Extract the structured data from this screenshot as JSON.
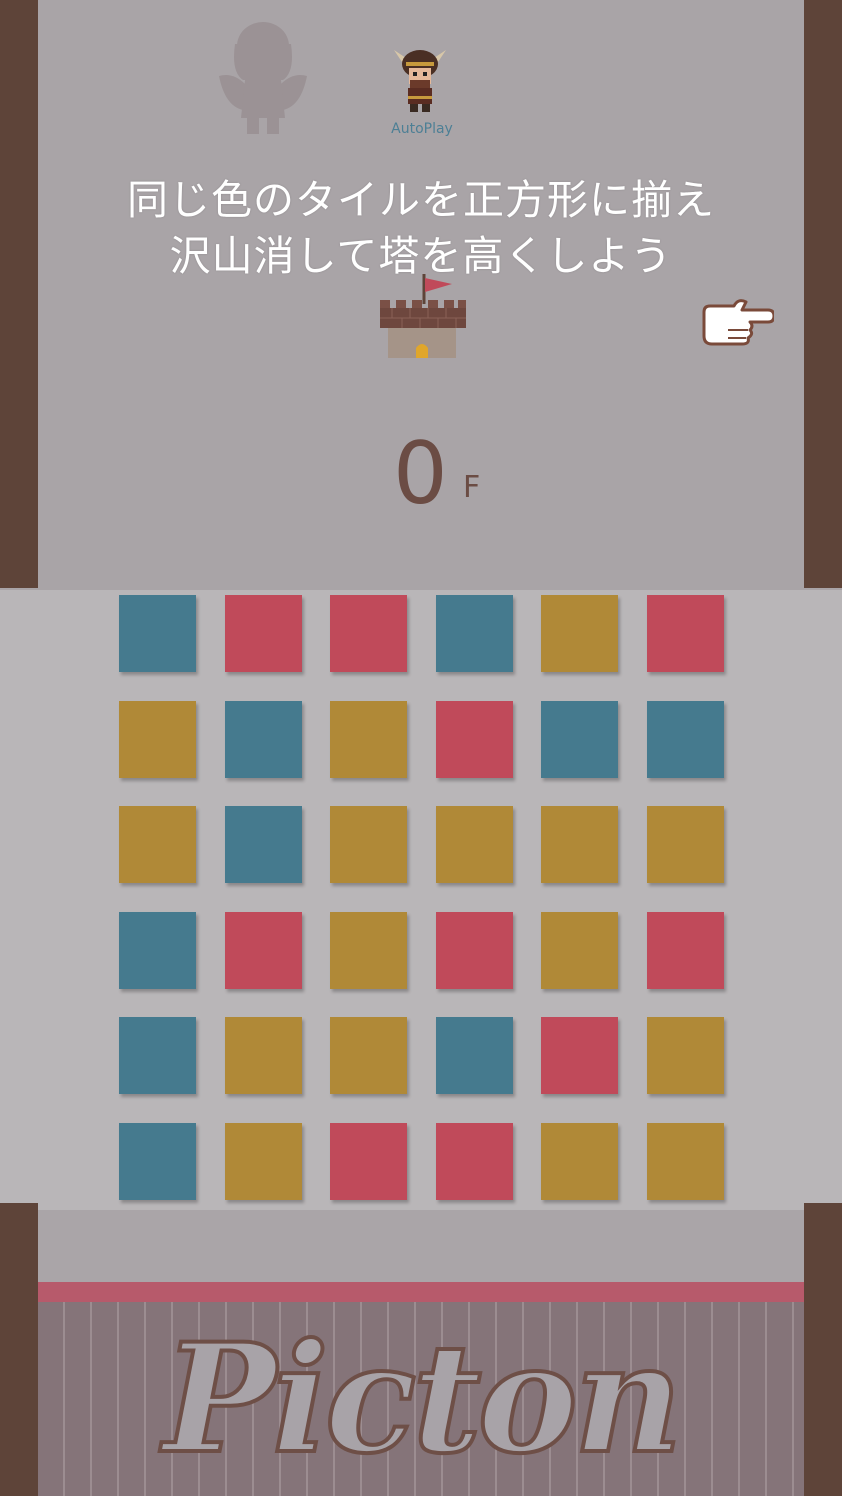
{
  "colors": {
    "blue": "#457a8e",
    "red": "#c04a5a",
    "yellow": "#b08937",
    "wall": "#5e4439",
    "text_dark": "#6b4c44",
    "band": "#b75a6b"
  },
  "characters": {
    "locked_icon": "angel-silhouette-icon",
    "autoplay_icon": "viking-character-icon",
    "autoplay_label": "AutoPlay"
  },
  "instructions": {
    "line1": "同じ色のタイルを正方形に揃え",
    "line2": "沢山消して塔を高くしよう"
  },
  "tower_icon": "castle-icon",
  "pointer_icon": "pointing-hand-icon",
  "floor": {
    "value": "0",
    "unit": "F"
  },
  "grid": [
    [
      "blue",
      "red",
      "red",
      "blue",
      "yellow",
      "red"
    ],
    [
      "yellow",
      "blue",
      "yellow",
      "red",
      "blue",
      "blue"
    ],
    [
      "yellow",
      "blue",
      "yellow",
      "yellow",
      "yellow",
      "yellow"
    ],
    [
      "blue",
      "red",
      "yellow",
      "red",
      "yellow",
      "red"
    ],
    [
      "blue",
      "yellow",
      "yellow",
      "blue",
      "red",
      "yellow"
    ],
    [
      "blue",
      "yellow",
      "red",
      "red",
      "yellow",
      "yellow"
    ]
  ],
  "logo": "Picton"
}
